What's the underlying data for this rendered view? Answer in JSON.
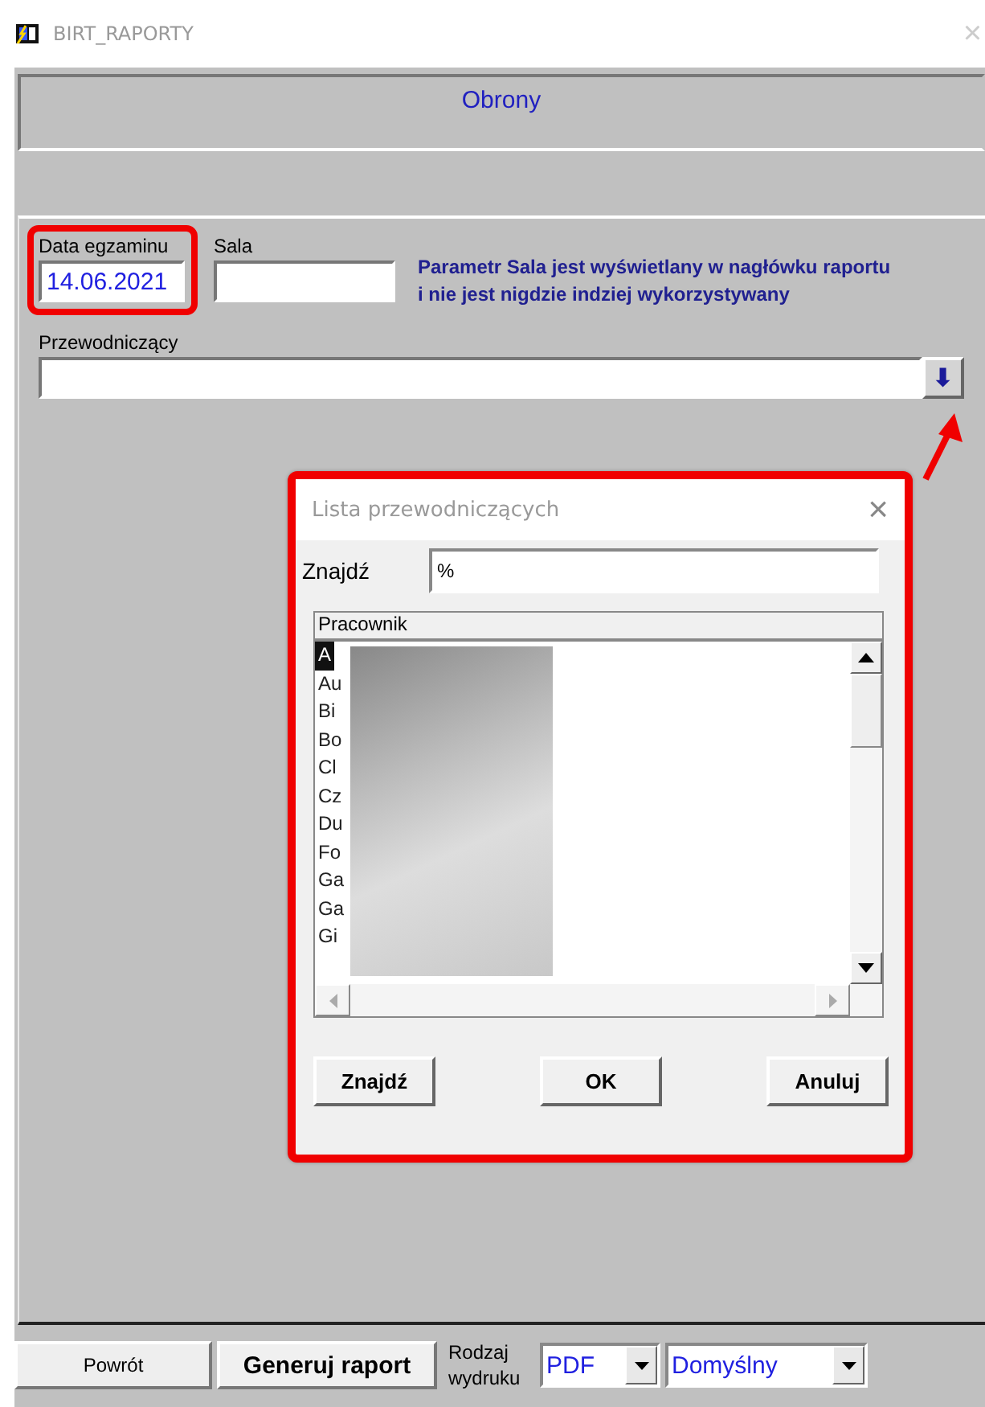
{
  "window": {
    "title": "BIRT_RAPORTY",
    "close": "×"
  },
  "header": {
    "title": "Obrony"
  },
  "form": {
    "date_label": "Data egzaminu",
    "date_value": "14.06.2021",
    "date_highlighted": true,
    "room_label": "Sala",
    "note": "Parametr Sala jest wyświetlany w nagłówku raportu i nie jest nigdzie indziej wykorzystywany",
    "chair_label": "Przewodniczący",
    "chair_button": "⬇",
    "callout_arrow": true
  },
  "dialog": {
    "title": "Lista przewodniczących",
    "close": "×",
    "highlighted": true,
    "search_label": "Znajdź",
    "search_value": "%",
    "column": "Pracownik",
    "redacted": true,
    "rows": [
      {
        "text": "A",
        "selected": true
      },
      {
        "text": "Au",
        "selected": false
      },
      {
        "text": "Bi",
        "selected": false
      },
      {
        "text": "Bo",
        "selected": false
      },
      {
        "text": "Cl",
        "selected": false
      },
      {
        "text": "Cz",
        "selected": false
      },
      {
        "text": "Du",
        "selected": false
      },
      {
        "text": "Fo",
        "selected": false
      },
      {
        "text": "Ga",
        "selected": false
      },
      {
        "text": "Ga",
        "selected": false
      },
      {
        "text": "Gi",
        "selected": false
      }
    ],
    "buttons": [
      "Znajdź",
      "OK",
      "Anuluj"
    ]
  },
  "bottom": {
    "back": "Powrót",
    "generate": "Generuj raport",
    "type_label": "Rodzaj wydruku",
    "format": "PDF",
    "printer": "Domyślny"
  }
}
